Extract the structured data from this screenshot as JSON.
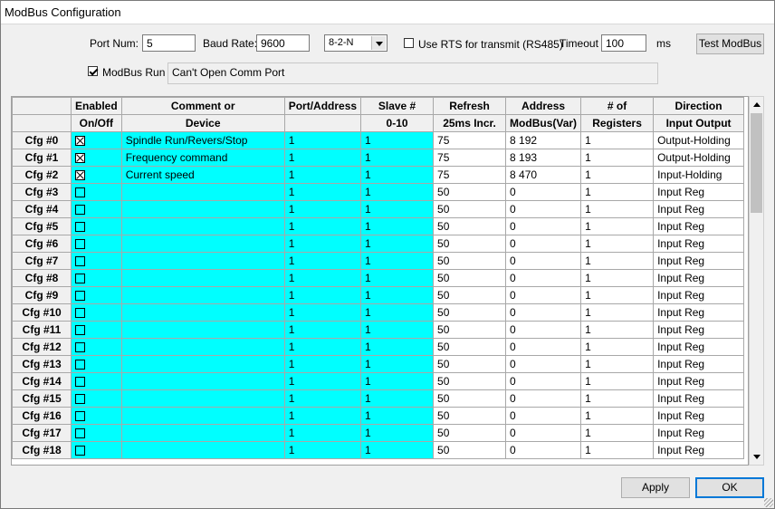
{
  "window": {
    "title": "ModBus Configuration"
  },
  "settings": {
    "port_num_label": "Port Num:",
    "port_num_value": "5",
    "baud_rate_label": "Baud Rate:",
    "baud_rate_value": "9600",
    "format_value": "8-2-N",
    "use_rts_label": "Use RTS for transmit (RS485)",
    "timeout_label": "Timeout",
    "timeout_value": "100",
    "timeout_unit": "ms",
    "test_button": "Test ModBus",
    "modbus_run_label": "ModBus Run",
    "status_text": "Can't Open Comm Port"
  },
  "table": {
    "header_row1": [
      "",
      "Enabled",
      "Comment or",
      "Port/Address",
      "Slave #",
      "Refresh",
      "Address",
      "# of",
      "Direction"
    ],
    "header_row2": [
      "",
      "On/Off",
      "Device",
      "",
      "0-10",
      "25ms Incr.",
      "ModBus(Var)",
      "Registers",
      "Input Output"
    ],
    "rows": [
      {
        "label": "Cfg #0",
        "comment": "Spindle Run/Revers/Stop",
        "port": "1",
        "slave": "1",
        "refresh": "75",
        "address": "8 192",
        "regs": "1",
        "direction": "Output-Holding"
      },
      {
        "label": "Cfg #1",
        "comment": "Frequency command",
        "port": "1",
        "slave": "1",
        "refresh": "75",
        "address": "8 193",
        "regs": "1",
        "direction": "Output-Holding"
      },
      {
        "label": "Cfg #2",
        "comment": "Current speed",
        "port": "1",
        "slave": "1",
        "refresh": "75",
        "address": "8 470",
        "regs": "1",
        "direction": "Input-Holding"
      },
      {
        "label": "Cfg #3",
        "comment": "",
        "port": "1",
        "slave": "1",
        "refresh": "50",
        "address": "0",
        "regs": "1",
        "direction": "Input Reg"
      },
      {
        "label": "Cfg #4",
        "comment": "",
        "port": "1",
        "slave": "1",
        "refresh": "50",
        "address": "0",
        "regs": "1",
        "direction": "Input Reg"
      },
      {
        "label": "Cfg #5",
        "comment": "",
        "port": "1",
        "slave": "1",
        "refresh": "50",
        "address": "0",
        "regs": "1",
        "direction": "Input Reg"
      },
      {
        "label": "Cfg #6",
        "comment": "",
        "port": "1",
        "slave": "1",
        "refresh": "50",
        "address": "0",
        "regs": "1",
        "direction": "Input Reg"
      },
      {
        "label": "Cfg #7",
        "comment": "",
        "port": "1",
        "slave": "1",
        "refresh": "50",
        "address": "0",
        "regs": "1",
        "direction": "Input Reg"
      },
      {
        "label": "Cfg #8",
        "comment": "",
        "port": "1",
        "slave": "1",
        "refresh": "50",
        "address": "0",
        "regs": "1",
        "direction": "Input Reg"
      },
      {
        "label": "Cfg #9",
        "comment": "",
        "port": "1",
        "slave": "1",
        "refresh": "50",
        "address": "0",
        "regs": "1",
        "direction": "Input Reg"
      },
      {
        "label": "Cfg #10",
        "comment": "",
        "port": "1",
        "slave": "1",
        "refresh": "50",
        "address": "0",
        "regs": "1",
        "direction": "Input Reg"
      },
      {
        "label": "Cfg #11",
        "comment": "",
        "port": "1",
        "slave": "1",
        "refresh": "50",
        "address": "0",
        "regs": "1",
        "direction": "Input Reg"
      },
      {
        "label": "Cfg #12",
        "comment": "",
        "port": "1",
        "slave": "1",
        "refresh": "50",
        "address": "0",
        "regs": "1",
        "direction": "Input Reg"
      },
      {
        "label": "Cfg #13",
        "comment": "",
        "port": "1",
        "slave": "1",
        "refresh": "50",
        "address": "0",
        "regs": "1",
        "direction": "Input Reg"
      },
      {
        "label": "Cfg #14",
        "comment": "",
        "port": "1",
        "slave": "1",
        "refresh": "50",
        "address": "0",
        "regs": "1",
        "direction": "Input Reg"
      },
      {
        "label": "Cfg #15",
        "comment": "",
        "port": "1",
        "slave": "1",
        "refresh": "50",
        "address": "0",
        "regs": "1",
        "direction": "Input Reg"
      },
      {
        "label": "Cfg #16",
        "comment": "",
        "port": "1",
        "slave": "1",
        "refresh": "50",
        "address": "0",
        "regs": "1",
        "direction": "Input Reg"
      },
      {
        "label": "Cfg #17",
        "comment": "",
        "port": "1",
        "slave": "1",
        "refresh": "50",
        "address": "0",
        "regs": "1",
        "direction": "Input Reg"
      },
      {
        "label": "Cfg #18",
        "comment": "",
        "port": "1",
        "slave": "1",
        "refresh": "50",
        "address": "0",
        "regs": "1",
        "direction": "Input Reg"
      }
    ],
    "enabled": [
      true,
      true,
      true,
      false,
      false,
      false,
      false,
      false,
      false,
      false,
      false,
      false,
      false,
      false,
      false,
      false,
      false,
      false,
      false
    ]
  },
  "buttons": {
    "apply": "Apply",
    "ok": "OK"
  }
}
